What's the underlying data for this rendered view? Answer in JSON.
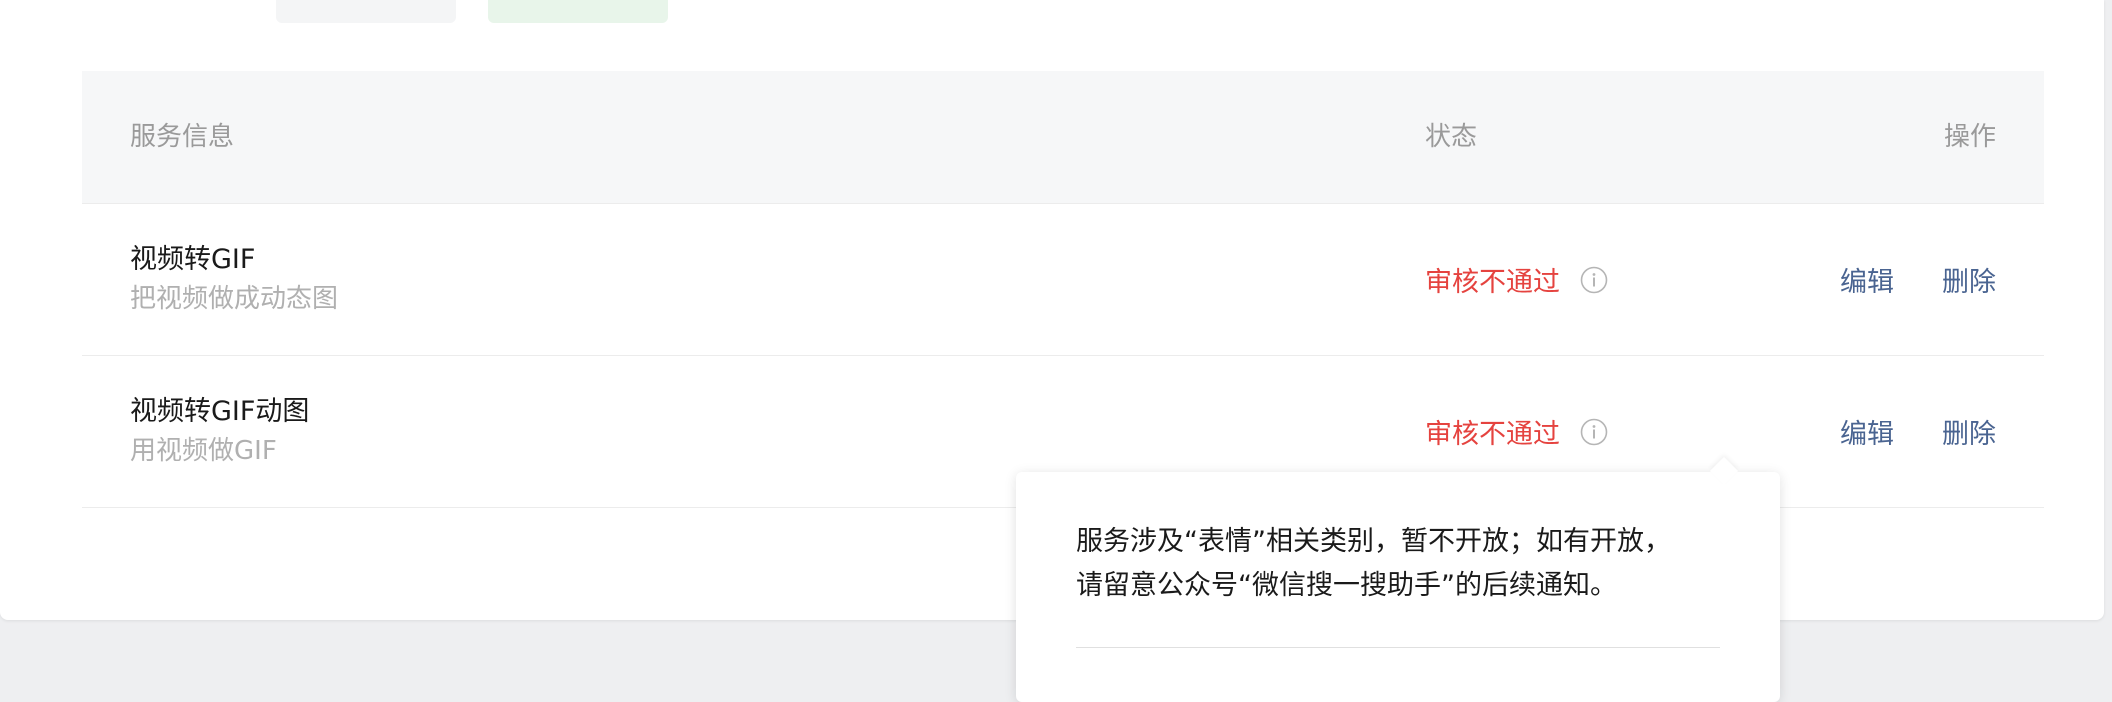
{
  "table": {
    "headers": {
      "info": "服务信息",
      "status": "状态",
      "ops": "操作"
    },
    "rows": [
      {
        "name": "视频转GIF",
        "desc": "把视频做成动态图",
        "status": "审核不通过",
        "edit": "编辑",
        "delete": "删除"
      },
      {
        "name": "视频转GIF动图",
        "desc": "用视频做GIF",
        "status": "审核不通过",
        "edit": "编辑",
        "delete": "删除"
      }
    ]
  },
  "popover": {
    "line1": "服务涉及“表情”相关类别，暂不开放；如有开放，",
    "line2": "请留意公众号“微信搜一搜助手”的后续通知。"
  },
  "colors": {
    "status_rejected": "#e5433f",
    "link": "#4a6491",
    "header_bg": "#f6f7f8"
  },
  "icons": {
    "status_info": "info-circle-icon"
  }
}
